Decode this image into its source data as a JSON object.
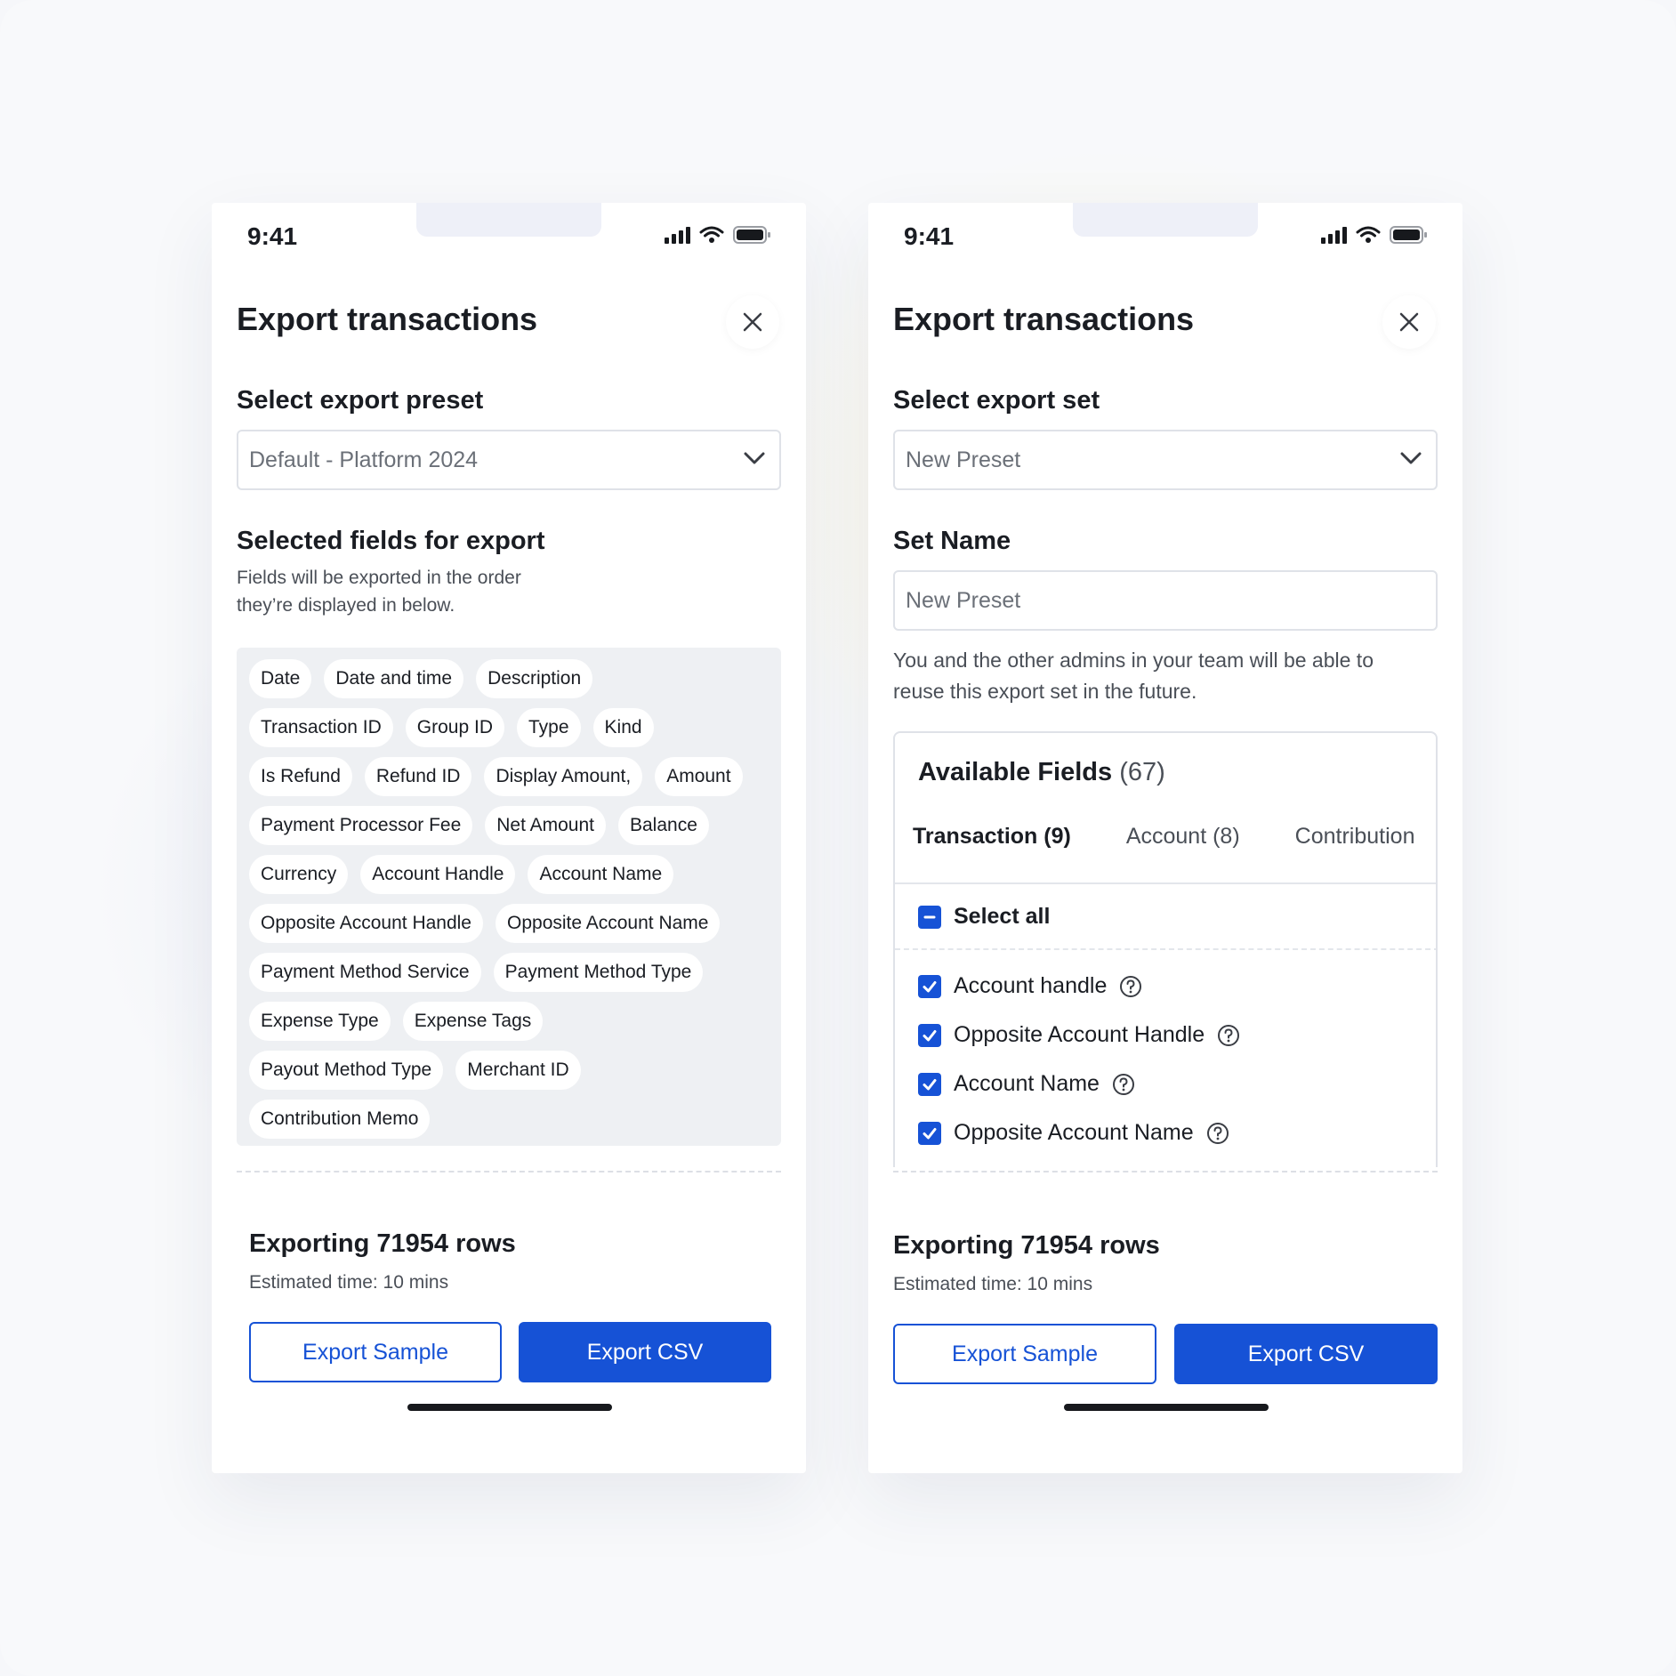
{
  "status_bar": {
    "time": "9:41"
  },
  "left": {
    "title": "Export transactions",
    "preset_label": "Select export preset",
    "preset_value": "Default - Platform 2024",
    "fields_title": "Selected fields for export",
    "fields_help_line1": "Fields will be exported in the order",
    "fields_help_line2": "they’re displayed in below.",
    "chip_rows": [
      [
        "Date",
        "Date and time",
        "Description"
      ],
      [
        "Transaction ID",
        "Group ID",
        "Type",
        "Kind"
      ],
      [
        "Is Refund",
        "Refund ID",
        "Display Amount,",
        "Amount"
      ],
      [
        "Payment Processor Fee",
        "Net Amount",
        "Balance"
      ],
      [
        "Currency",
        "Account Handle",
        "Account Name"
      ],
      [
        "Opposite Account Handle",
        "Opposite Account Name"
      ],
      [
        "Payment Method Service",
        "Payment Method Type"
      ],
      [
        "Expense Type",
        "Expense Tags"
      ],
      [
        "Payout Method Type",
        "Merchant ID"
      ],
      [
        "Contribution Memo"
      ]
    ],
    "export_count": "Exporting 71954 rows",
    "estimate": "Estimated time: 10 mins",
    "sample_button": "Export Sample",
    "csv_button": "Export CSV"
  },
  "right": {
    "title": "Export transactions",
    "set_label": "Select export set",
    "set_value": "New Preset",
    "set_name_label": "Set Name",
    "set_name_placeholder": "New Preset",
    "set_name_help_line1": "You and the other admins in your team will be able to",
    "set_name_help_line2": "reuse this export set in the future.",
    "available_fields_label": "Available Fields",
    "available_fields_count": "(67)",
    "tabs": [
      "Transaction (9)",
      "Account (8)",
      "Contribution"
    ],
    "active_tab": "Transaction (9)",
    "select_all": "Select all",
    "fields": [
      "Account handle",
      "Opposite Account Handle",
      "Account Name",
      "Opposite Account Name"
    ],
    "export_count": "Exporting 71954 rows",
    "estimate": "Estimated time: 10 mins",
    "sample_button": "Export Sample",
    "csv_button": "Export CSV"
  },
  "colors": {
    "accent": "#1652d6",
    "text": "#1a1d23",
    "muted": "#4a4f57",
    "chip_bg": "#eef0f3"
  }
}
